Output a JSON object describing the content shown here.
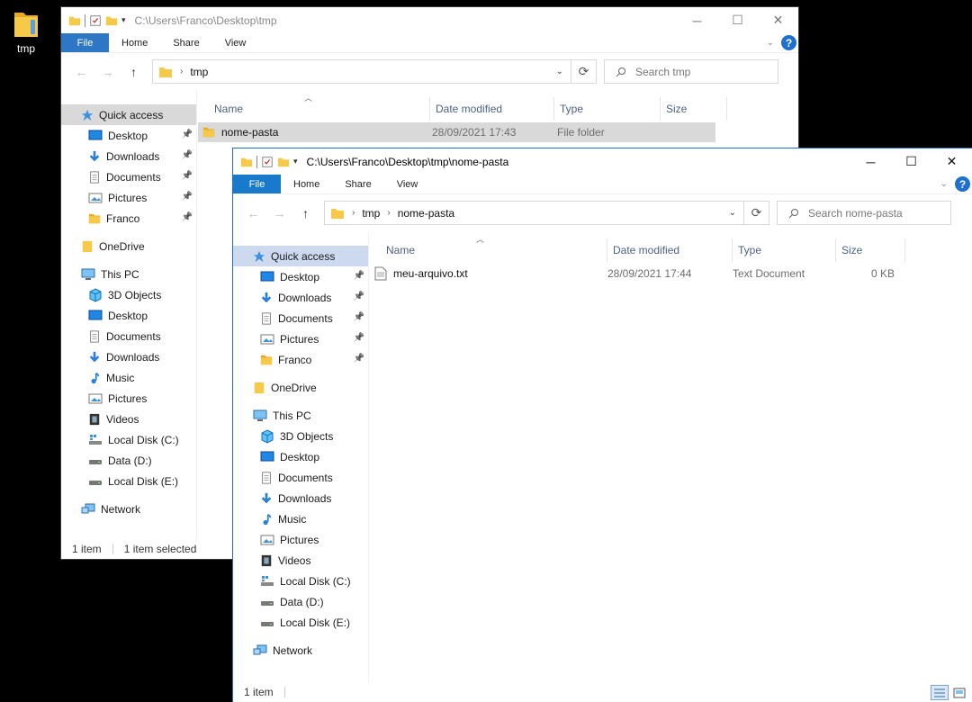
{
  "desktop": {
    "icon_label": "tmp"
  },
  "window1": {
    "title": "C:\\Users\\Franco\\Desktop\\tmp",
    "ribbon_tabs": [
      "File",
      "Home",
      "Share",
      "View"
    ],
    "breadcrumb": [
      "tmp"
    ],
    "search_placeholder": "Search tmp",
    "columns": [
      "Name",
      "Date modified",
      "Type",
      "Size"
    ],
    "files": [
      {
        "name": "nome-pasta",
        "date": "28/09/2021 17:43",
        "type": "File folder",
        "size": "",
        "icon": "folder-icon",
        "selected": true
      }
    ],
    "status": {
      "count": "1 item",
      "selected": "1 item selected"
    }
  },
  "window2": {
    "title": "C:\\Users\\Franco\\Desktop\\tmp\\nome-pasta",
    "ribbon_tabs": [
      "File",
      "Home",
      "Share",
      "View"
    ],
    "breadcrumb": [
      "tmp",
      "nome-pasta"
    ],
    "search_placeholder": "Search nome-pasta",
    "columns": [
      "Name",
      "Date modified",
      "Type",
      "Size"
    ],
    "files": [
      {
        "name": "meu-arquivo.txt",
        "date": "28/09/2021 17:44",
        "type": "Text Document",
        "size": "0 KB",
        "icon": "text-file-icon",
        "selected": false
      }
    ],
    "status": {
      "count": "1 item"
    }
  },
  "nav_pane": {
    "quick_access": "Quick access",
    "pinned": [
      {
        "label": "Desktop",
        "icon": "desktop-icon"
      },
      {
        "label": "Downloads",
        "icon": "downloads-icon"
      },
      {
        "label": "Documents",
        "icon": "documents-icon"
      },
      {
        "label": "Pictures",
        "icon": "pictures-icon"
      },
      {
        "label": "Franco",
        "icon": "folder-icon"
      }
    ],
    "onedrive": "OneDrive",
    "this_pc": "This PC",
    "pc_items": [
      {
        "label": "3D Objects",
        "icon": "3d-objects-icon"
      },
      {
        "label": "Desktop",
        "icon": "desktop-icon"
      },
      {
        "label": "Documents",
        "icon": "documents-icon"
      },
      {
        "label": "Downloads",
        "icon": "downloads-icon"
      },
      {
        "label": "Music",
        "icon": "music-icon"
      },
      {
        "label": "Pictures",
        "icon": "pictures-icon"
      },
      {
        "label": "Videos",
        "icon": "videos-icon"
      },
      {
        "label": "Local Disk (C:)",
        "icon": "system-disk-icon"
      },
      {
        "label": "Data (D:)",
        "icon": "drive-icon"
      },
      {
        "label": "Local Disk (E:)",
        "icon": "drive-icon"
      }
    ],
    "network": "Network"
  },
  "colors": {
    "accent": "#1979ca",
    "selection": "#ccd9ee",
    "inactive_selection": "#d9d9d9",
    "column_header_text": "#4d6185",
    "folder": "#f7c948"
  }
}
